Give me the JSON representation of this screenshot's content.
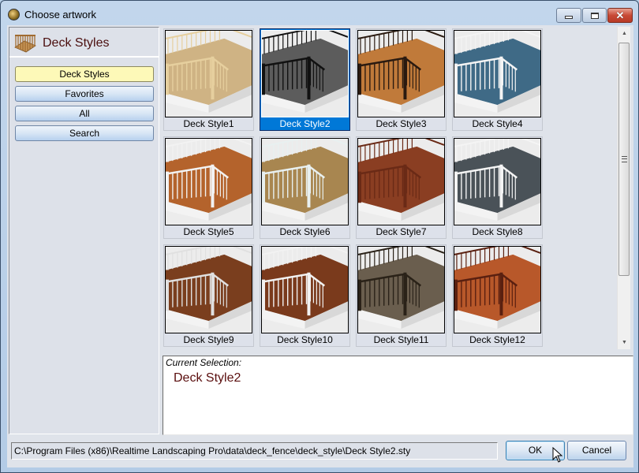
{
  "window": {
    "title": "Choose artwork",
    "controls": {
      "minimize": "minimize",
      "maximize": "maximize",
      "close": "✕"
    }
  },
  "sidebar": {
    "header_title": "Deck Styles",
    "buttons": [
      {
        "label": "Deck Styles",
        "active": true
      },
      {
        "label": "Favorites",
        "active": false
      },
      {
        "label": "All",
        "active": false
      },
      {
        "label": "Search",
        "active": false
      }
    ]
  },
  "gallery": {
    "items": [
      {
        "label": "Deck Style1",
        "deck": "#cfb384",
        "rail": "#e6cf9e",
        "selected": false
      },
      {
        "label": "Deck Style2",
        "deck": "#5c5c5c",
        "rail": "#111111",
        "selected": true
      },
      {
        "label": "Deck Style3",
        "deck": "#c07a3a",
        "rail": "#2a1a10",
        "selected": false
      },
      {
        "label": "Deck Style4",
        "deck": "#3f6a86",
        "rail": "#f4f4f4",
        "selected": false
      },
      {
        "label": "Deck Style5",
        "deck": "#b4632c",
        "rail": "#f2f2f2",
        "selected": false
      },
      {
        "label": "Deck Style6",
        "deck": "#a88650",
        "rail": "#e8f0f0",
        "selected": false
      },
      {
        "label": "Deck Style7",
        "deck": "#8a3e22",
        "rail": "#6a2a16",
        "selected": false
      },
      {
        "label": "Deck Style8",
        "deck": "#4a5258",
        "rail": "#f4f4f4",
        "selected": false
      },
      {
        "label": "Deck Style9",
        "deck": "#7a3e1e",
        "rail": "#e0e0e0",
        "selected": false
      },
      {
        "label": "Deck Style10",
        "deck": "#7a3a1c",
        "rail": "#f2f2f2",
        "selected": false
      },
      {
        "label": "Deck Style11",
        "deck": "#6a5e4e",
        "rail": "#2a2218",
        "selected": false
      },
      {
        "label": "Deck Style12",
        "deck": "#b8582a",
        "rail": "#5a2010",
        "selected": false
      }
    ]
  },
  "selection": {
    "label": "Current Selection:",
    "value": "Deck Style2"
  },
  "footer": {
    "path": "C:\\Program Files (x86)\\Realtime Landscaping Pro\\data\\deck_fence\\deck_style\\Deck Style2.sty",
    "ok_label": "OK",
    "cancel_label": "Cancel"
  },
  "colors": {
    "selection_blue": "#0078d7",
    "active_nav": "#fdf9b8",
    "title_text": "#4a0e0e"
  }
}
